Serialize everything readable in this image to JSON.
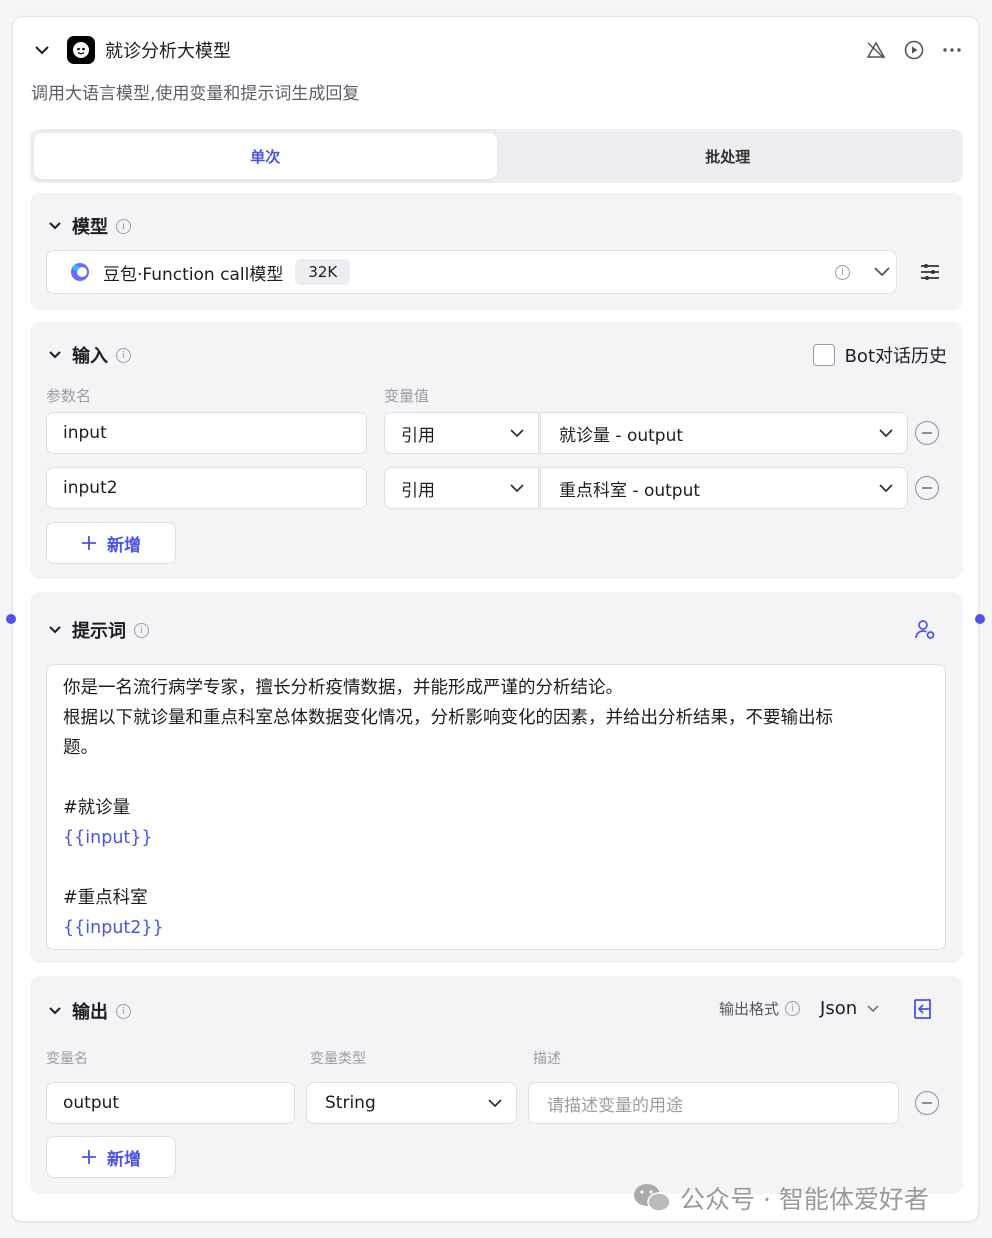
{
  "node": {
    "title": "就诊分析大模型",
    "description": "调用大语言模型,使用变量和提示词生成回复"
  },
  "tabs": {
    "single": "单次",
    "batch": "批处理"
  },
  "model_section": {
    "title": "模型",
    "model_name": "豆包·Function call模型",
    "context_badge": "32K"
  },
  "input_section": {
    "title": "输入",
    "history_label": "Bot对话历史",
    "col_param": "参数名",
    "col_value": "变量值",
    "rows": [
      {
        "name": "input",
        "ref_type": "引用",
        "value": "就诊量 - output"
      },
      {
        "name": "input2",
        "ref_type": "引用",
        "value": "重点科室 - output"
      }
    ],
    "add_label": "新增"
  },
  "prompt_section": {
    "title": "提示词",
    "lines": [
      "你是一名流行病学专家，擅长分析疫情数据，并能形成严谨的分析结论。",
      "根据以下就诊量和重点科室总体数据变化情况，分析影响变化的因素，并给出分析结果，不要输出标",
      "题。",
      "#就诊量",
      "{{input}}",
      "#重点科室",
      "{{input2}}"
    ]
  },
  "output_section": {
    "title": "输出",
    "format_label": "输出格式",
    "format_value": "Json",
    "col_name": "变量名",
    "col_type": "变量类型",
    "col_desc": "描述",
    "row": {
      "name": "output",
      "type": "String",
      "desc_placeholder": "请描述变量的用途"
    },
    "add_label": "新增"
  },
  "watermark": "公众号 · 智能体爱好者",
  "colors": {
    "accent": "#4d53e8",
    "section_bg": "#f4f4f7"
  }
}
